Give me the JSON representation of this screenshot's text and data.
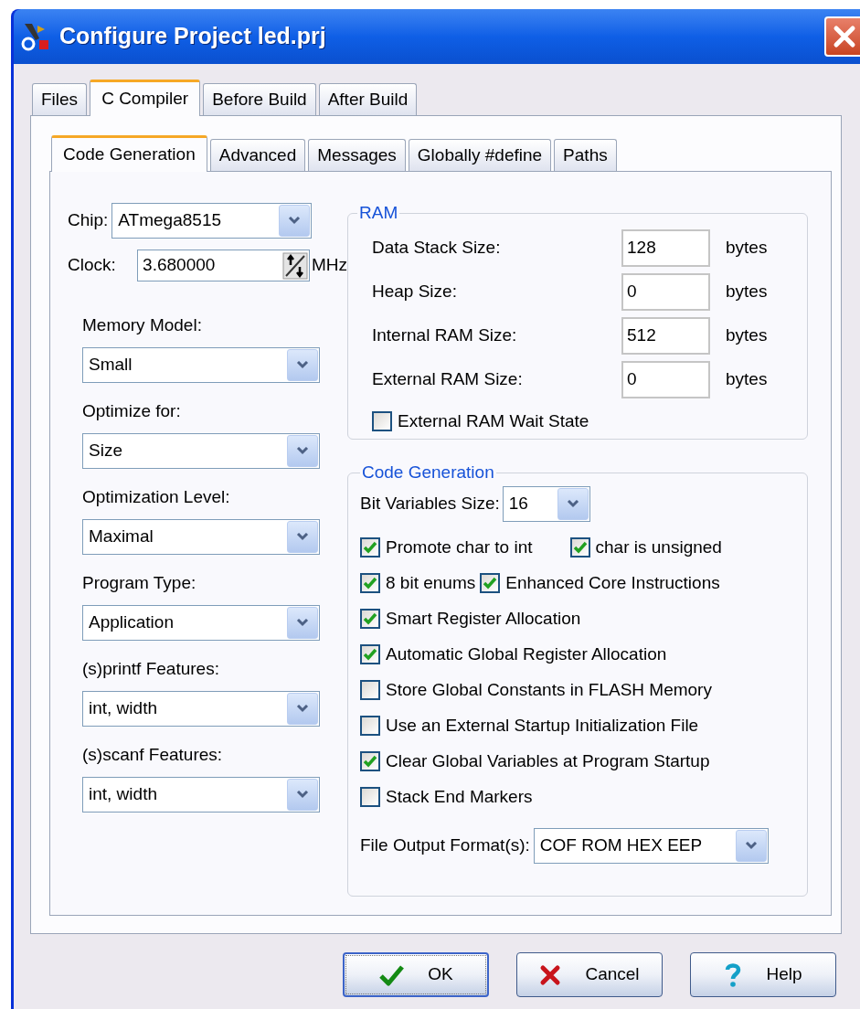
{
  "window": {
    "title": "Configure Project led.prj"
  },
  "tabs": [
    {
      "label": "Files",
      "selected": false
    },
    {
      "label": "C Compiler",
      "selected": true
    },
    {
      "label": "Before Build",
      "selected": false
    },
    {
      "label": "After Build",
      "selected": false
    }
  ],
  "subtabs": [
    {
      "label": "Code Generation",
      "selected": true
    },
    {
      "label": "Advanced",
      "selected": false
    },
    {
      "label": "Messages",
      "selected": false
    },
    {
      "label": "Globally #define",
      "selected": false
    },
    {
      "label": "Paths",
      "selected": false
    }
  ],
  "chip": {
    "label": "Chip:",
    "value": "ATmega8515"
  },
  "clock": {
    "label": "Clock:",
    "value": "3.680000",
    "unit": "MHz"
  },
  "left_fields": [
    {
      "label": "Memory Model:",
      "value": "Small"
    },
    {
      "label": "Optimize for:",
      "value": "Size"
    },
    {
      "label": "Optimization Level:",
      "value": "Maximal"
    },
    {
      "label": "Program Type:",
      "value": "Application"
    },
    {
      "label": "(s)printf Features:",
      "value": "int, width"
    },
    {
      "label": "(s)scanf Features:",
      "value": "int, width"
    }
  ],
  "ram": {
    "title": "RAM",
    "fields": [
      {
        "label": "Data Stack Size:",
        "value": "128",
        "unit": "bytes"
      },
      {
        "label": "Heap Size:",
        "value": "0",
        "unit": "bytes"
      },
      {
        "label": "Internal RAM Size:",
        "value": "512",
        "unit": "bytes"
      },
      {
        "label": "External RAM Size:",
        "value": "0",
        "unit": "bytes"
      }
    ],
    "wait_state": {
      "label": "External RAM Wait State",
      "checked": false
    }
  },
  "code_generation": {
    "title": "Code Generation",
    "bit_variables": {
      "label": "Bit Variables Size:",
      "value": "16"
    },
    "option_rows": [
      [
        {
          "label": "Promote char to int",
          "checked": true
        },
        {
          "label": "char is unsigned",
          "checked": true
        }
      ],
      [
        {
          "label": "8 bit enums",
          "checked": true
        },
        {
          "label": "Enhanced Core Instructions",
          "checked": true
        }
      ],
      [
        {
          "label": "Smart Register Allocation",
          "checked": true
        }
      ],
      [
        {
          "label": "Automatic Global Register Allocation",
          "checked": true
        }
      ],
      [
        {
          "label": "Store Global Constants in FLASH Memory",
          "checked": false
        }
      ],
      [
        {
          "label": "Use an External Startup Initialization File",
          "checked": false
        }
      ],
      [
        {
          "label": "Clear Global Variables at Program Startup",
          "checked": true
        }
      ],
      [
        {
          "label": "Stack End Markers",
          "checked": false
        }
      ]
    ],
    "output": {
      "label": "File Output Format(s):",
      "value": "COF ROM HEX EEP"
    }
  },
  "buttons": [
    {
      "label": "OK",
      "kind": "ok",
      "focused": true
    },
    {
      "label": "Cancel",
      "kind": "cancel",
      "focused": false
    },
    {
      "label": "Help",
      "kind": "help",
      "focused": false
    }
  ]
}
